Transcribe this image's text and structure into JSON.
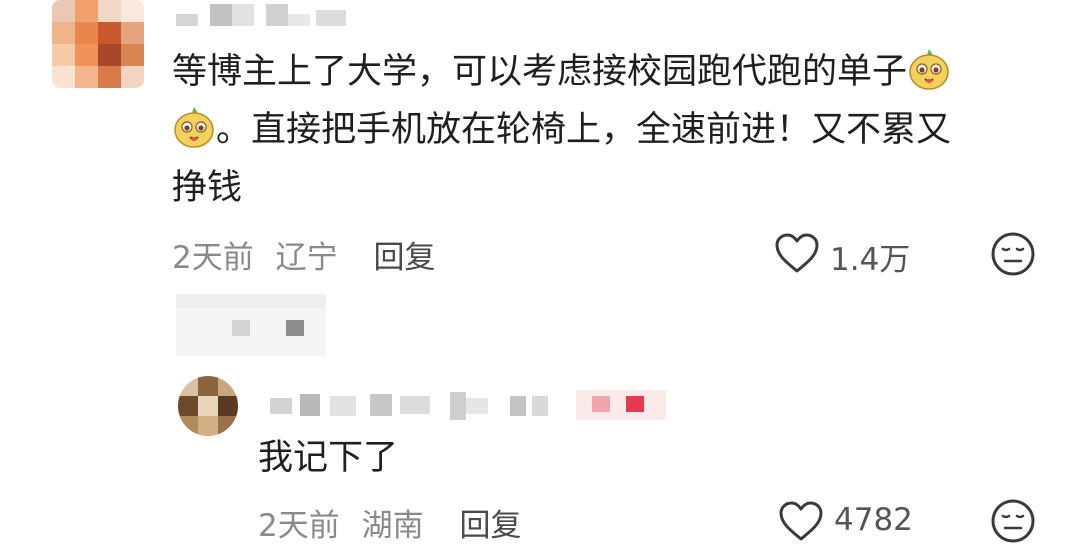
{
  "comment": {
    "text_line1": "等博主上了大学，可以考虑接校园跑代跑的单子",
    "text_line2_suffix": "。直接把手机放在轮椅上，全速前进！又不累又",
    "text_line3": "挣钱",
    "time": "2天前",
    "location": "辽宁",
    "reply_label": "回复",
    "likes": "1.4万",
    "emoji_icon": "potato-face-emoji-icon",
    "like_icon": "heart-outline-icon",
    "dislike_icon": "meh-face-icon"
  },
  "reply": {
    "text": "我记下了",
    "time": "2天前",
    "location": "湖南",
    "reply_label": "回复",
    "likes": "4782",
    "like_icon": "heart-outline-icon",
    "dislike_icon": "meh-face-icon"
  },
  "colors": {
    "text": "#1f1f1f",
    "meta": "#8a8a8a",
    "icon": "#3a3a3a",
    "mosaic_red": "#e8384f"
  }
}
